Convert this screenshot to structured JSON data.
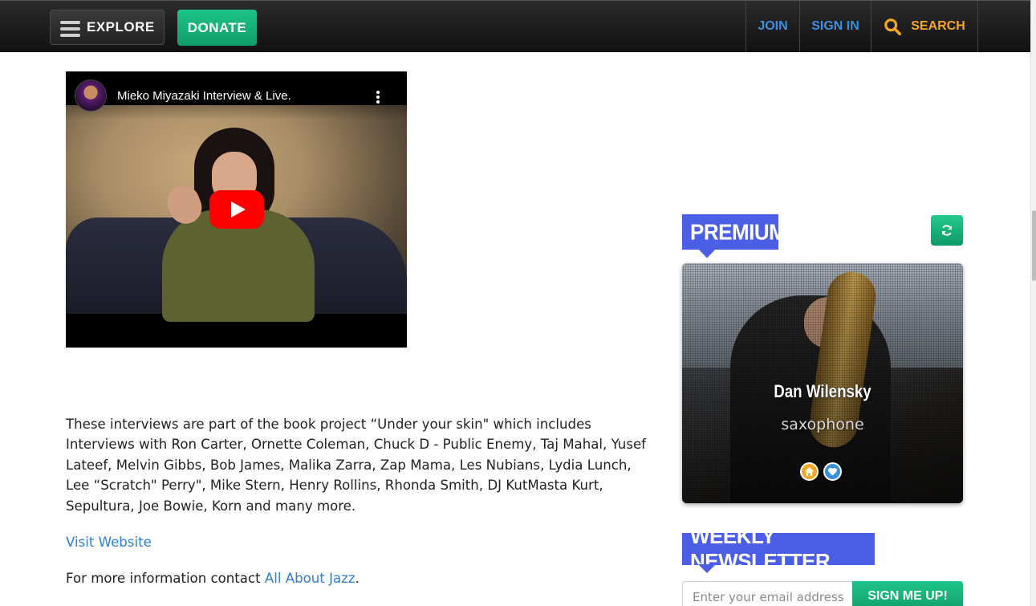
{
  "nav": {
    "explore_label": "EXPLORE",
    "donate_label": "DONATE",
    "join_label": "JOIN",
    "signin_label": "SIGN IN",
    "search_label": "SEARCH",
    "colors": {
      "bar": "#111111",
      "link": "#3b8fe0",
      "search": "#f5a623",
      "donate": "#13b07a"
    }
  },
  "video": {
    "title": "Mieko Miyazaki Interview & Live.",
    "icons": [
      "channel-avatar",
      "more-vert-icon",
      "play-icon"
    ]
  },
  "article": {
    "paragraph": "These interviews are part of the book project “Under your skin\" which includes Interviews with Ron Carter, Ornette Coleman, Chuck D - Public Enemy, Taj Mahal, Yusef Lateef, Melvin Gibbs, Bob James, Malika Zarra, Zap Mama, Les Nubians, Lydia Lunch, Lee “Scratch\" Perry\", Mike Stern, Henry Rollins, Rhonda Smith, DJ KutMasta Kurt, Sepultura, Joe Bowie, Korn and many more.",
    "visit_link": "Visit Website",
    "contact_prefix": "For more information contact ",
    "contact_link": "All About Jazz",
    "contact_suffix": "."
  },
  "sidebar": {
    "premium_heading": "PREMIUM",
    "refresh_icon": "refresh-icon",
    "card": {
      "name": "Dan Wilensky",
      "instrument": "saxophone",
      "icons": [
        "home-icon",
        "heart-icon"
      ]
    },
    "newsletter_heading": "WEEKLY NEWSLETTER",
    "email_placeholder": "Enter your email address",
    "signup_label": "SIGN ME UP!",
    "colors": {
      "ribbon": "#4a5fe6",
      "button": "#13b07a"
    }
  }
}
